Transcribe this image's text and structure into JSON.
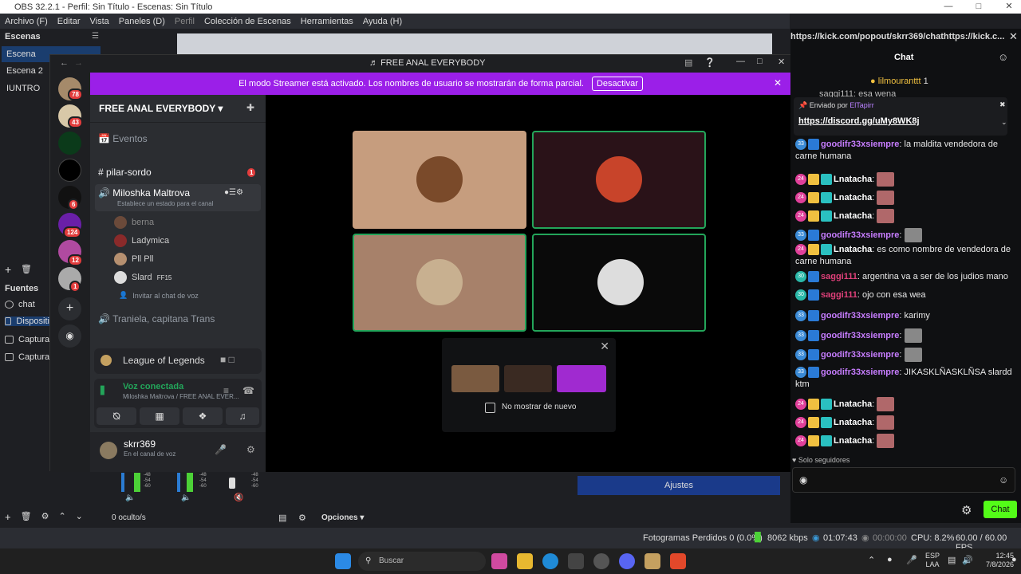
{
  "obs": {
    "title": "OBS 32.2.1 - Perfil: Sin Título - Escenas: Sin Título",
    "menu": [
      "Archivo (F)",
      "Editar",
      "Vista",
      "Paneles (D)",
      "Perfil",
      "Colección de Escenas",
      "Herramientas",
      "Ayuda (H)"
    ],
    "scenes_title": "Escenas",
    "scenes": [
      "Escena",
      "Escena 2",
      "IUNTRO"
    ],
    "sources_title": "Fuentes",
    "sources": [
      "chat",
      "Dispositi",
      "Captura",
      "Captura"
    ],
    "hidden_count": "0 oculto/s",
    "options_label": "Opciones",
    "settings_label": "Ajustes",
    "meter_labels": [
      "-48",
      "-54",
      "-60"
    ],
    "status": {
      "frames": "Fotogramas Perdidos 0 (0.0%)",
      "bitrate": "8062 kbps",
      "live": "01:07:43",
      "rec": "00:00:00",
      "cpu": "CPU: 8.2%",
      "fps": "60.00 / 60.00 FPS"
    }
  },
  "discord": {
    "window_title": "FREE ANAL EVERYBODY",
    "banner_text": "El modo Streamer está activado. Los nombres de usuario se mostrarán de forma parcial.",
    "banner_button": "Desactivar",
    "server_name": "FREE ANAL EVERYBODY",
    "events": "Eventos",
    "text_channel": "pilar-sordo",
    "text_badge": "1",
    "voice_channel": "Miloshka Maltrova",
    "voice_status": "Establece un estado para el canal",
    "voice_users": [
      "berna",
      "Ladymica",
      "Pll Pll",
      "Slard"
    ],
    "slard_tag": "FF15",
    "invite": "Invitar al chat de voz",
    "other_channel": "Traniela, capitana Trans",
    "server_badges": [
      "78",
      "43",
      "6",
      "124",
      "12",
      "1"
    ],
    "activity": "League of Legends",
    "voice_connected": "Voz conectada",
    "voice_path": "Miloshka Maltrova / FREE ANAL EVER...",
    "user": "skrr369",
    "user_status": "En el canal de voz",
    "dont_show": "No mostrar de nuevo"
  },
  "chat": {
    "url": "https://kick.com/popout/skrr369/chathttps://kick.c...",
    "title": "Chat",
    "top_user": "lilmouranttt",
    "top_count": "1",
    "partial": "saggi111: esa wena",
    "pinned_by": "Enviado por",
    "pinned_user": "ElTapirr",
    "pinned_link": "https://discord.gg/uMy8WK8j",
    "messages": [
      {
        "badge": "33",
        "user": "goodifr33xsiempre",
        "color": "#c77dff",
        "text": "la maldita vendedora de carne humana",
        "emote": false,
        "crown": false
      },
      {
        "badge": "24",
        "user": "Lnatacha",
        "color": "#ffffff",
        "text": "",
        "emote": true,
        "crown": true
      },
      {
        "badge": "24",
        "user": "Lnatacha",
        "color": "#ffffff",
        "text": "",
        "emote": true,
        "crown": true
      },
      {
        "badge": "24",
        "user": "Lnatacha",
        "color": "#ffffff",
        "text": "",
        "emote": true,
        "crown": true
      },
      {
        "badge": "33",
        "user": "goodifr33xsiempre",
        "color": "#c77dff",
        "text": "",
        "emote": true,
        "crown": false
      },
      {
        "badge": "24",
        "user": "Lnatacha",
        "color": "#ffffff",
        "text": "es como nombre de vendedora de carne humana",
        "emote": false,
        "crown": true
      },
      {
        "badge": "30",
        "user": "saggi111",
        "color": "#e0407a",
        "text": "argentina va a ser de los judios mano",
        "emote": false,
        "crown": false
      },
      {
        "badge": "30",
        "user": "saggi111",
        "color": "#e0407a",
        "text": "ojo con esa wea",
        "emote": false,
        "crown": false
      },
      {
        "badge": "33",
        "user": "goodifr33xsiempre",
        "color": "#c77dff",
        "text": "karimy",
        "emote": false,
        "crown": false
      },
      {
        "badge": "33",
        "user": "goodifr33xsiempre",
        "color": "#c77dff",
        "text": "",
        "emote": true,
        "crown": false
      },
      {
        "badge": "33",
        "user": "goodifr33xsiempre",
        "color": "#c77dff",
        "text": "",
        "emote": true,
        "crown": false
      },
      {
        "badge": "33",
        "user": "goodifr33xsiempre",
        "color": "#c77dff",
        "text": "JIKASKLÑASKLÑSA slardd ktm",
        "emote": false,
        "crown": false
      },
      {
        "badge": "24",
        "user": "Lnatacha",
        "color": "#ffffff",
        "text": "",
        "emote": true,
        "crown": true
      },
      {
        "badge": "24",
        "user": "Lnatacha",
        "color": "#ffffff",
        "text": "",
        "emote": true,
        "crown": true
      },
      {
        "badge": "24",
        "user": "Lnatacha",
        "color": "#ffffff",
        "text": "",
        "emote": true,
        "crown": true
      }
    ],
    "followers_only": "Solo seguidores",
    "send_button": "Chat"
  },
  "taskbar": {
    "search": "Buscar",
    "lang1": "ESP",
    "lang2": "LAA",
    "time": "12:45",
    "date": "7/8/2026"
  },
  "colors": {
    "streamer_banner": "#9b1fe8",
    "kick_green": "#53fc18",
    "voice_green": "#23a55a"
  }
}
